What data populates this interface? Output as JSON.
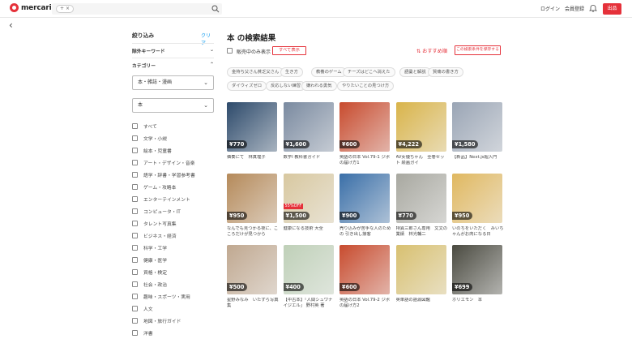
{
  "header": {
    "logo_text": "mercari",
    "search_chip": "×",
    "search_chip_plus": "+",
    "login": "ログイン",
    "signup": "会員登録",
    "sell": "出品"
  },
  "sidebar": {
    "title": "絞り込み",
    "clear": "クリア",
    "keyword_section": "除外キーワード",
    "category_section": "カテゴリー",
    "select1": "本・雑誌・漫画",
    "select2": "本",
    "categories": [
      "すべて",
      "文学・小説",
      "絵本・児童書",
      "アート・デザイン・音楽",
      "語学・辞書・学習参考書",
      "ゲーム・攻略本",
      "エンターテインメント",
      "コンピュータ・IT",
      "タレント写真集",
      "ビジネス・経済",
      "科学・工学",
      "健康・医学",
      "資格・検定",
      "社会・政治",
      "趣味・スポーツ・実用",
      "人文",
      "地図・旅行ガイド",
      "洋書"
    ]
  },
  "main": {
    "title": "本 の検索結果",
    "onsale": "販売中のみ表示",
    "show_all": "すべて表示",
    "sort": "おすすめ順",
    "save": "この検索条件を保存する",
    "tags": [
      "金持ち父さん貧乏父さん",
      "生き方",
      "教養のゲーム",
      "チーズはどこへ消えた",
      "語彙と解説",
      "質痛の書き方",
      "ダイウィズゼロ",
      "反応しない練習",
      "嫌われる勇気",
      "やりたいことの見つけ方"
    ],
    "items": [
      {
        "price": "¥770",
        "text": "価奏にて　林真理子",
        "color": "#2d4a6b"
      },
      {
        "price": "¥1,600",
        "text": "数学I 教科書ガイド",
        "color": "#7a8aa0"
      },
      {
        "price": "¥600",
        "text": "英語の日本 Vol.79-1 ジボの届け方1",
        "color": "#c84b2e"
      },
      {
        "price": "¥4,222",
        "text": "AV女優ちゃん　全巻セット 絵画ガイ",
        "color": "#d9b44a"
      },
      {
        "price": "¥1,580",
        "text": "【新品】Next.js超入門",
        "color": "#9aa5b5"
      },
      {
        "price": "¥950",
        "text": "なんでも見つかる夜に、こころだけが見つから",
        "color": "#b58a5a"
      },
      {
        "price": "¥1,500",
        "text": "健康になる技術 大全",
        "color": "#d8c8a0",
        "pct": "55%OFF"
      },
      {
        "price": "¥900",
        "text": "売り込みが苦手な人のための 引き出し接客",
        "color": "#3a6fa8"
      },
      {
        "price": "¥770",
        "text": "特異三郎さん専用　文文の業績　林光輔二",
        "color": "#a8a8a0"
      },
      {
        "price": "¥950",
        "text": "いのちをいただく　みいちゃんがお肉になる日",
        "color": "#e0b860"
      },
      {
        "price": "¥500",
        "text": "星野みなみ　いたずら写真集",
        "color": "#c0a890"
      },
      {
        "price": "¥400",
        "text": "【中古本】「人間シュワナイジエル」 野村英 著",
        "color": "#bfd0b8"
      },
      {
        "price": "¥600",
        "text": "英語の日本 Vol.79-2 ジボの届け方2",
        "color": "#c84b2e"
      },
      {
        "price": "",
        "text": "英単語の語源図鑑",
        "color": "#d8c070"
      },
      {
        "price": "¥699",
        "text": "ホリエモン　本",
        "color": "#4a4a40"
      }
    ]
  },
  "colors": {
    "accent": "#e5313a",
    "link": "#0095ee"
  }
}
